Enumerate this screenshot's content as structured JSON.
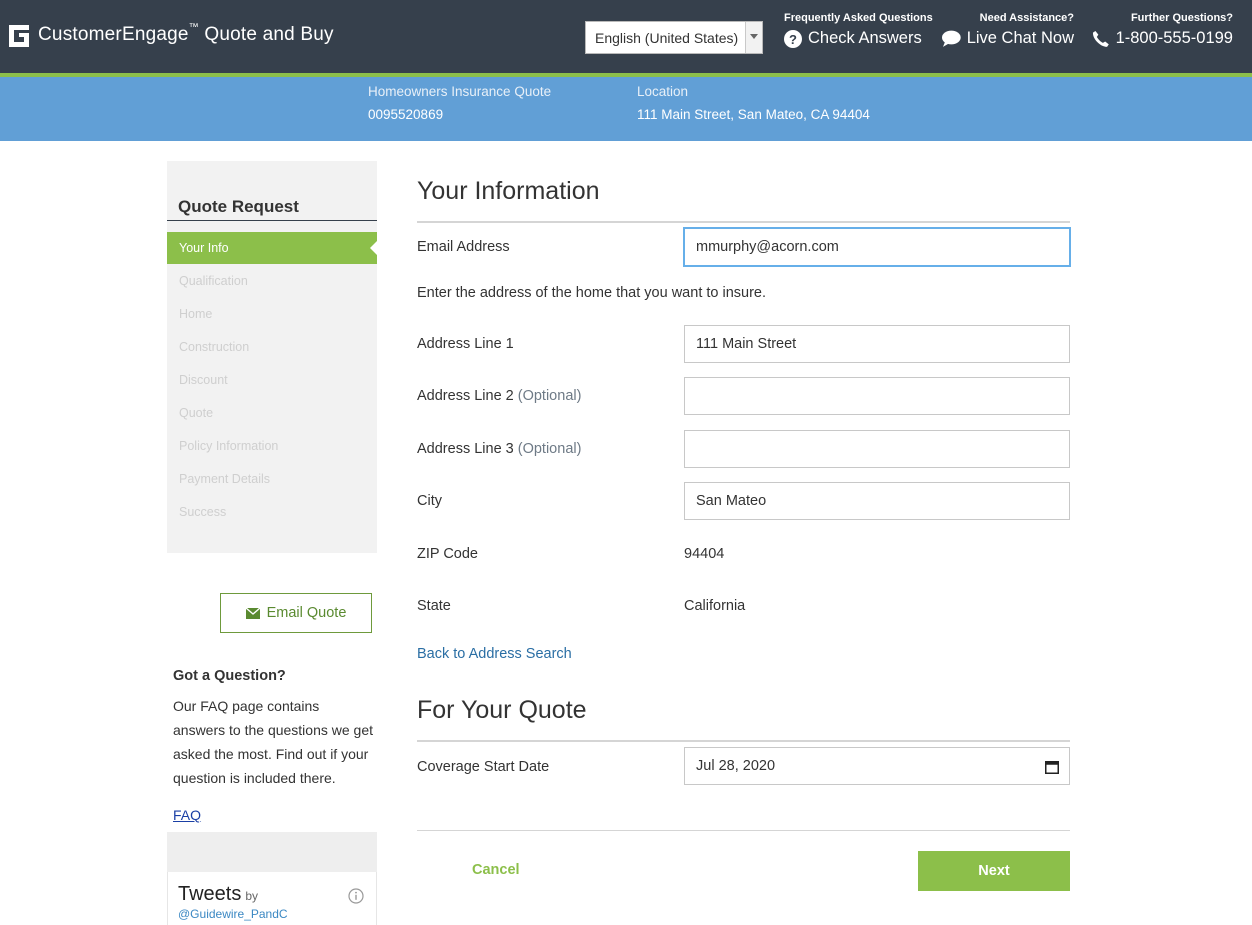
{
  "header": {
    "brand": "CustomerEngage",
    "brand_tm": "™",
    "brand_suffix": " Quote and Buy",
    "language": "English (United States)",
    "faq_caption": "Frequently Asked Questions",
    "faq_link": "Check Answers",
    "chat_caption": "Need Assistance?",
    "chat_link": "Live Chat Now",
    "phone_caption": "Further Questions?",
    "phone_link": "1-800-555-0199",
    "colors": {
      "bar": "#36404c",
      "accent": "#8cbf4a"
    }
  },
  "quote_bar": {
    "quote_caption": "Homeowners Insurance Quote",
    "quote_number": "0095520869",
    "location_caption": "Location",
    "location_value": "111 Main Street, San Mateo, CA 94404",
    "color": "#619fd6"
  },
  "sidebar": {
    "title": "Quote Request",
    "steps": [
      {
        "label": "Your Info",
        "active": true
      },
      {
        "label": "Qualification",
        "active": false
      },
      {
        "label": "Home",
        "active": false
      },
      {
        "label": "Construction",
        "active": false
      },
      {
        "label": "Discount",
        "active": false
      },
      {
        "label": "Quote",
        "active": false
      },
      {
        "label": "Policy Information",
        "active": false
      },
      {
        "label": "Payment Details",
        "active": false
      },
      {
        "label": "Success",
        "active": false
      }
    ],
    "email_quote_button": "Email Quote",
    "question_title": "Got a Question?",
    "question_text": "Our FAQ page contains answers to the questions we get asked the most. Find out if your question is included there.",
    "faq_link": "FAQ",
    "tweets_title": "Tweets",
    "tweets_by": "by",
    "tweets_handle": "@Guidewire_PandC"
  },
  "your_information": {
    "title": "Your Information",
    "email_label": "Email Address",
    "email_value": "mmurphy@acorn.com",
    "instruction": "Enter the address of the home that you want to insure.",
    "address1_label": "Address Line 1",
    "address1_value": "111 Main Street",
    "address2_label": "Address Line 2",
    "address2_optional": "(Optional)",
    "address2_value": "",
    "address3_label": "Address Line 3",
    "address3_optional": "(Optional)",
    "address3_value": "",
    "city_label": "City",
    "city_value": "San Mateo",
    "zip_label": "ZIP Code",
    "zip_value": "94404",
    "state_label": "State",
    "state_value": "California",
    "back_link": "Back to Address Search"
  },
  "for_your_quote": {
    "title": "For Your Quote",
    "start_date_label": "Coverage Start Date",
    "start_date_value": "Jul 28, 2020"
  },
  "actions": {
    "cancel": "Cancel",
    "next": "Next"
  }
}
